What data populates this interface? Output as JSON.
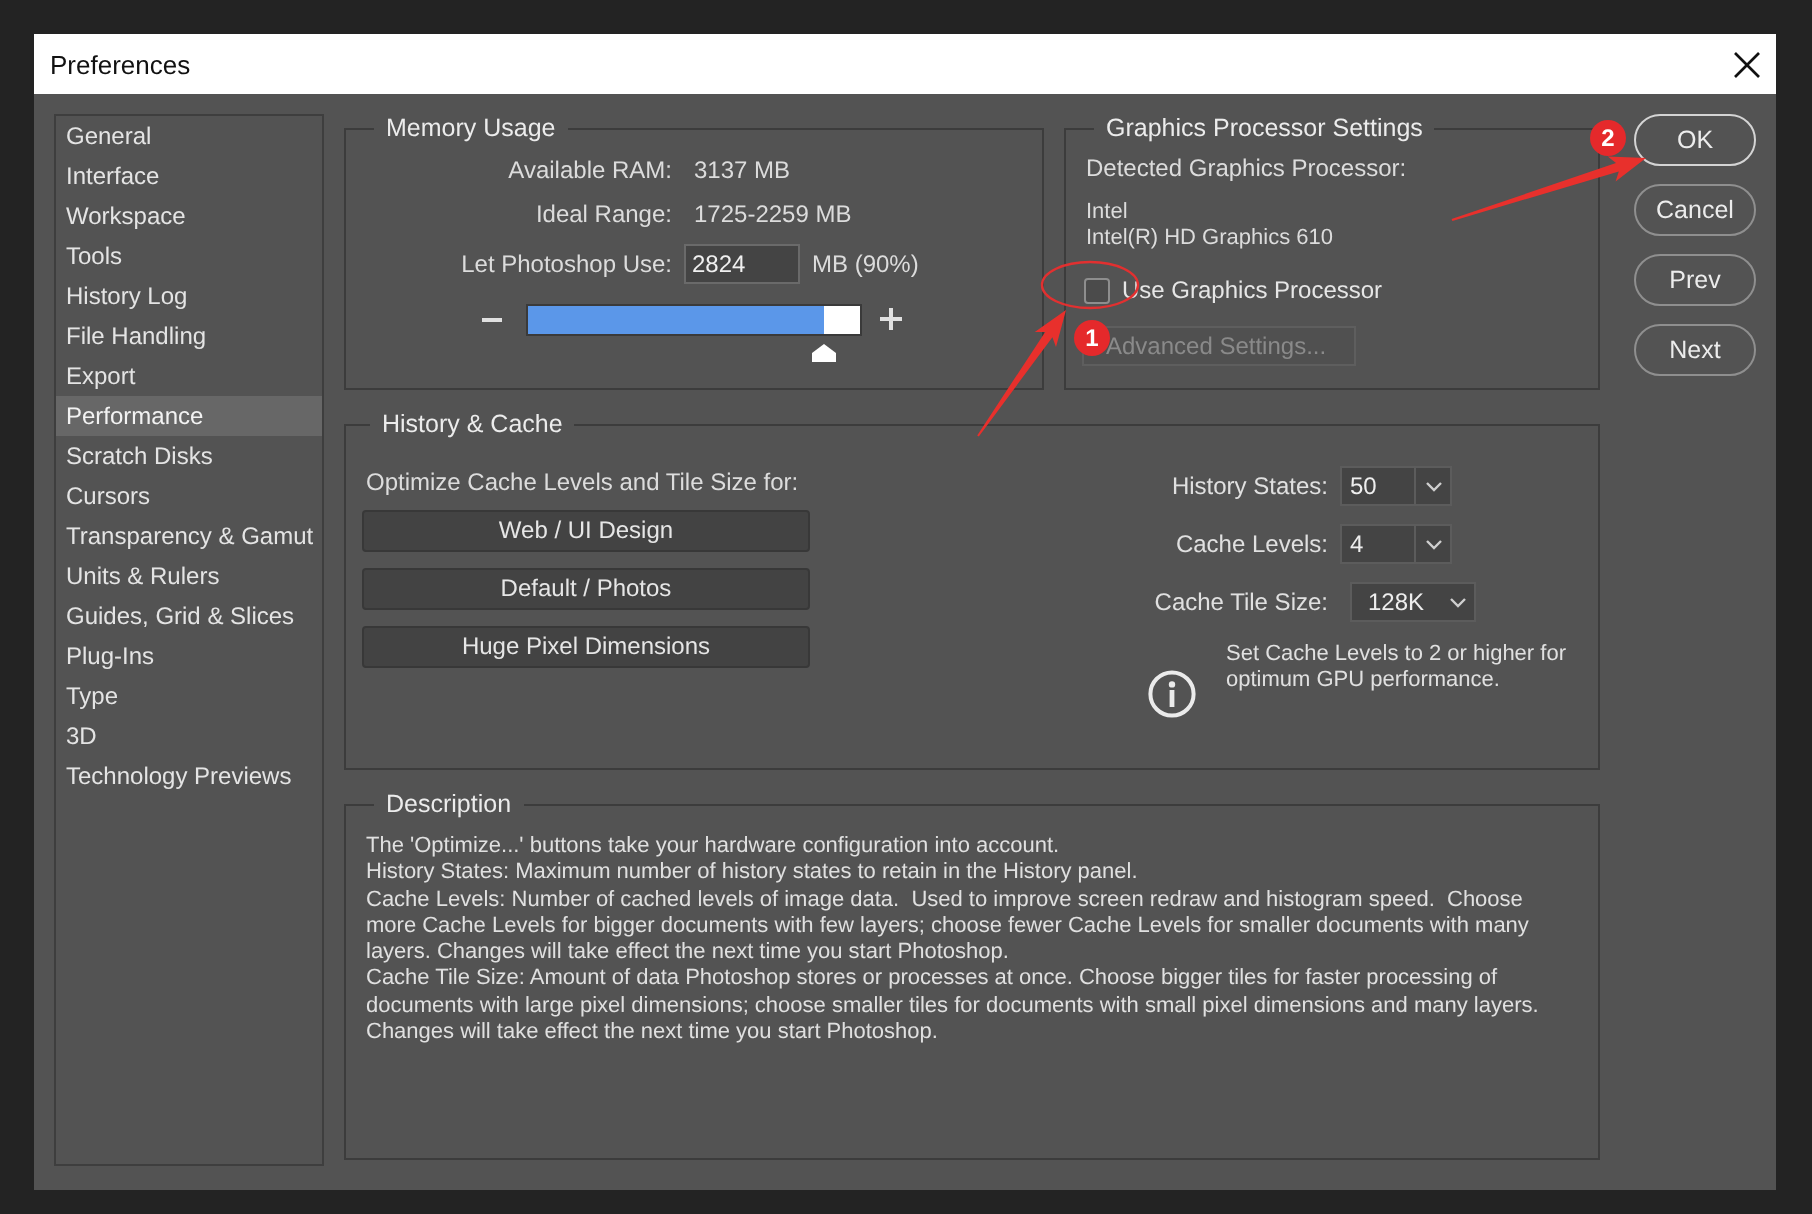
{
  "window": {
    "title": "Preferences"
  },
  "sidebar": {
    "items": [
      {
        "label": "General",
        "selected": false
      },
      {
        "label": "Interface",
        "selected": false
      },
      {
        "label": "Workspace",
        "selected": false
      },
      {
        "label": "Tools",
        "selected": false
      },
      {
        "label": "History Log",
        "selected": false
      },
      {
        "label": "File Handling",
        "selected": false
      },
      {
        "label": "Export",
        "selected": false
      },
      {
        "label": "Performance",
        "selected": true
      },
      {
        "label": "Scratch Disks",
        "selected": false
      },
      {
        "label": "Cursors",
        "selected": false
      },
      {
        "label": "Transparency & Gamut",
        "selected": false
      },
      {
        "label": "Units & Rulers",
        "selected": false
      },
      {
        "label": "Guides, Grid & Slices",
        "selected": false
      },
      {
        "label": "Plug-Ins",
        "selected": false
      },
      {
        "label": "Type",
        "selected": false
      },
      {
        "label": "3D",
        "selected": false
      },
      {
        "label": "Technology Previews",
        "selected": false
      }
    ]
  },
  "memory_usage": {
    "title": "Memory Usage",
    "rows": [
      {
        "label": "Available RAM:",
        "value": "3137 MB"
      },
      {
        "label": "Ideal Range:",
        "value": "1725-2259 MB"
      }
    ],
    "use": {
      "label": "Let Photoshop Use:",
      "value": "2824",
      "unit": "MB (90%)"
    },
    "slider": {
      "level": 0.89
    }
  },
  "graphics_processor": {
    "title": "Graphics Processor Settings",
    "detected_label": "Detected Graphics Processor:",
    "vendor": "Intel",
    "model": "Intel(R) HD Graphics 610",
    "use_gpu": {
      "label": "Use Graphics Processor",
      "checked": false
    },
    "advanced_button": {
      "label": "Advanced Settings...",
      "disabled": true
    }
  },
  "history_cache": {
    "title": "History & Cache",
    "optimize_label": "Optimize Cache Levels and Tile Size for:",
    "presets": [
      "Web / UI Design",
      "Default / Photos",
      "Huge Pixel Dimensions"
    ],
    "fields": [
      {
        "label": "History States:",
        "value": "50",
        "kind": "combo"
      },
      {
        "label": "Cache Levels:",
        "value": "4",
        "kind": "combo"
      },
      {
        "label": "Cache Tile Size:",
        "value": "128K",
        "kind": "dropdown"
      }
    ],
    "note": "Set Cache Levels to 2 or higher for optimum GPU performance."
  },
  "description": {
    "title": "Description",
    "paragraphs": [
      "The 'Optimize...' buttons take your hardware configuration into account.",
      "History States: Maximum number of history states to retain in the History panel.",
      "Cache Levels: Number of cached levels of image data.  Used to improve screen redraw and histogram speed.  Choose more Cache Levels for bigger documents with few layers; choose fewer Cache Levels for smaller documents with many layers. Changes will take effect the next time you start Photoshop.",
      "Cache Tile Size: Amount of data Photoshop stores or processes at once. Choose bigger tiles for faster processing of documents with large pixel dimensions; choose smaller tiles for documents with small pixel dimensions and many layers. Changes will take effect the next time you start Photoshop."
    ]
  },
  "buttons": [
    {
      "label": "OK",
      "default": true
    },
    {
      "label": "Cancel",
      "default": false
    },
    {
      "label": "Prev",
      "default": false
    },
    {
      "label": "Next",
      "default": false
    }
  ],
  "annotations": [
    {
      "number": "1",
      "ring": true
    },
    {
      "number": "2",
      "ring": false
    }
  ]
}
